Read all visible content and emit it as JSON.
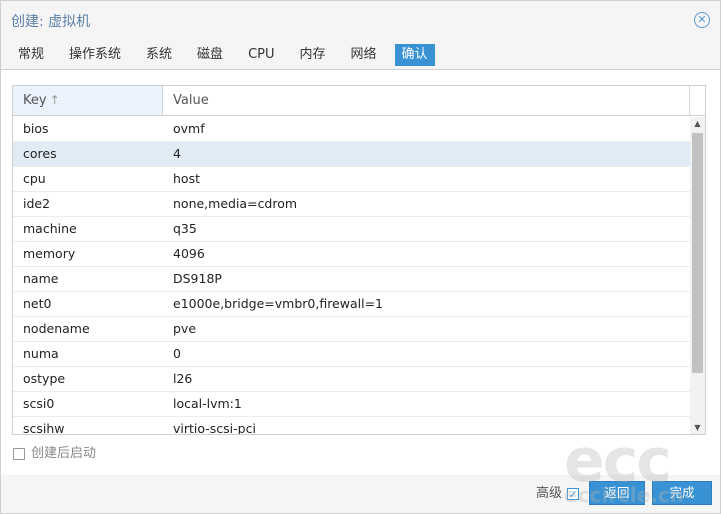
{
  "window": {
    "title": "创建: 虚拟机"
  },
  "tabs": [
    {
      "label": "常规",
      "active": false
    },
    {
      "label": "操作系统",
      "active": false
    },
    {
      "label": "系统",
      "active": false
    },
    {
      "label": "磁盘",
      "active": false
    },
    {
      "label": "CPU",
      "active": false
    },
    {
      "label": "内存",
      "active": false
    },
    {
      "label": "网络",
      "active": false
    },
    {
      "label": "确认",
      "active": true
    }
  ],
  "grid": {
    "columns": {
      "key": "Key",
      "value": "Value",
      "sort_indicator": "↑"
    },
    "rows": [
      {
        "key": "bios",
        "value": "ovmf"
      },
      {
        "key": "cores",
        "value": "4"
      },
      {
        "key": "cpu",
        "value": "host"
      },
      {
        "key": "ide2",
        "value": "none,media=cdrom"
      },
      {
        "key": "machine",
        "value": "q35"
      },
      {
        "key": "memory",
        "value": "4096"
      },
      {
        "key": "name",
        "value": "DS918P"
      },
      {
        "key": "net0",
        "value": "e1000e,bridge=vmbr0,firewall=1"
      },
      {
        "key": "nodename",
        "value": "pve"
      },
      {
        "key": "numa",
        "value": "0"
      },
      {
        "key": "ostype",
        "value": "l26"
      },
      {
        "key": "scsi0",
        "value": "local-lvm:1"
      },
      {
        "key": "scsihw",
        "value": "virtio-scsi-pci"
      }
    ],
    "selected_row": 1
  },
  "autostart": {
    "label": "创建后启动",
    "checked": false
  },
  "footer": {
    "advanced_label": "高级",
    "advanced_checked": true,
    "back_label": "返回",
    "finish_label": "完成"
  },
  "watermark": {
    "big": "ecc",
    "small": "eccircle.cn"
  },
  "colors": {
    "accent": "#3892d4",
    "title": "#5b7fa6",
    "selected_row": "#e1ebf6"
  }
}
